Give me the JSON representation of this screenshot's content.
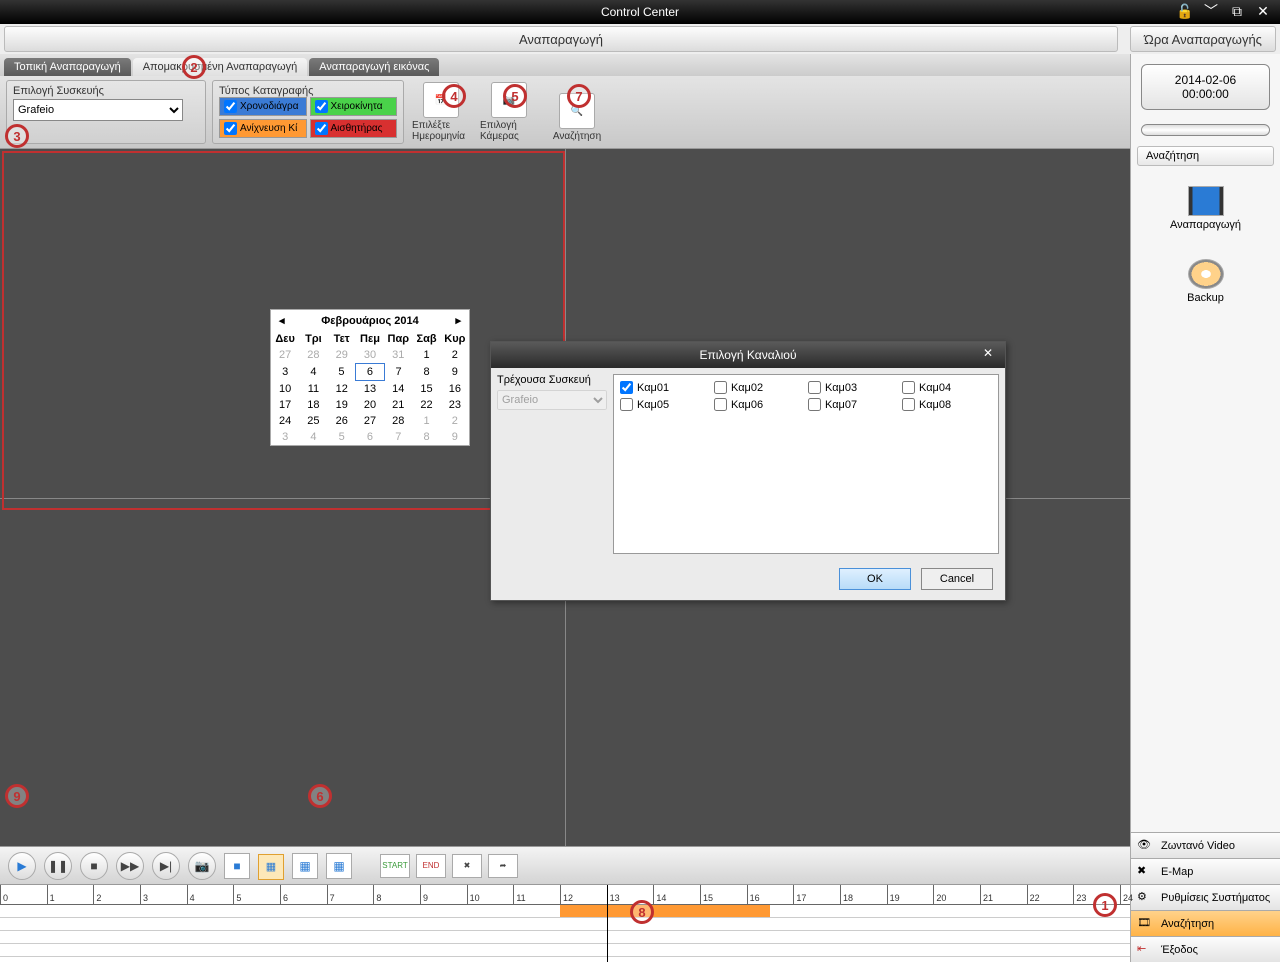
{
  "window": {
    "title": "Control Center"
  },
  "topband": "Αναπαραγωγή",
  "tabs": [
    {
      "label": "Τοπική Αναπαραγωγή",
      "active": false
    },
    {
      "label": "Απομακρυσμένη Αναπαραγωγή",
      "active": true
    },
    {
      "label": "Αναπαραγωγή εικόνας",
      "active": false
    }
  ],
  "device": {
    "label": "Επιλογή Συσκευής",
    "value": "Grafeio"
  },
  "recordtype": {
    "label": "Τύπος Καταγραφής",
    "items": [
      {
        "label": "Χρονοδιάγρα",
        "checked": true,
        "class": "rt-blue"
      },
      {
        "label": "Χειροκίνητα",
        "checked": true,
        "class": "rt-green"
      },
      {
        "label": "Ανίχνευση Κί",
        "checked": true,
        "class": "rt-orange"
      },
      {
        "label": "Αισθητήρας",
        "checked": true,
        "class": "rt-red"
      }
    ]
  },
  "toolbar": {
    "date": "Επιλέξτε Ημερομηνία",
    "camera": "Επιλογή Κάμερας",
    "search": "Αναζήτηση"
  },
  "calendar": {
    "title": "Φεβρουάριος 2014",
    "dow": [
      "Δευ",
      "Τρι",
      "Τετ",
      "Πεμ",
      "Παρ",
      "Σαβ",
      "Κυρ"
    ],
    "weeks": [
      [
        "27",
        "28",
        "29",
        "30",
        "31",
        "1",
        "2"
      ],
      [
        "3",
        "4",
        "5",
        "6",
        "7",
        "8",
        "9"
      ],
      [
        "10",
        "11",
        "12",
        "13",
        "14",
        "15",
        "16"
      ],
      [
        "17",
        "18",
        "19",
        "20",
        "21",
        "22",
        "23"
      ],
      [
        "24",
        "25",
        "26",
        "27",
        "28",
        "1",
        "2"
      ],
      [
        "3",
        "4",
        "5",
        "6",
        "7",
        "8",
        "9"
      ]
    ],
    "selected": "6"
  },
  "dialog": {
    "title": "Επιλογή Καναλιού",
    "device_label": "Τρέχουσα Συσκευή",
    "device_value": "Grafeio",
    "channels": [
      {
        "label": "Καμ01",
        "checked": true
      },
      {
        "label": "Καμ02",
        "checked": false
      },
      {
        "label": "Καμ03",
        "checked": false
      },
      {
        "label": "Καμ04",
        "checked": false
      },
      {
        "label": "Καμ05",
        "checked": false
      },
      {
        "label": "Καμ06",
        "checked": false
      },
      {
        "label": "Καμ07",
        "checked": false
      },
      {
        "label": "Καμ08",
        "checked": false
      }
    ],
    "ok": "OK",
    "cancel": "Cancel"
  },
  "sidebar": {
    "title": "Ώρα Αναπαραγωγής",
    "time_date": "2014-02-06",
    "time_time": "00:00:00",
    "search": "Αναζήτηση",
    "playback": "Αναπαραγωγή",
    "backup": "Backup",
    "menu": [
      {
        "label": "Ζωντανό Video"
      },
      {
        "label": "E-Map"
      },
      {
        "label": "Ρυθμίσεις Συστήματος"
      },
      {
        "label": "Αναζήτηση"
      },
      {
        "label": "Έξοδος"
      }
    ]
  },
  "timeline": {
    "marker_hour": 13,
    "segments": [
      {
        "row": 0,
        "start": 12,
        "end": 16.5,
        "class": "o1"
      }
    ]
  },
  "annotations": [
    "1",
    "2",
    "3",
    "4",
    "5",
    "6",
    "7",
    "8",
    "9"
  ]
}
